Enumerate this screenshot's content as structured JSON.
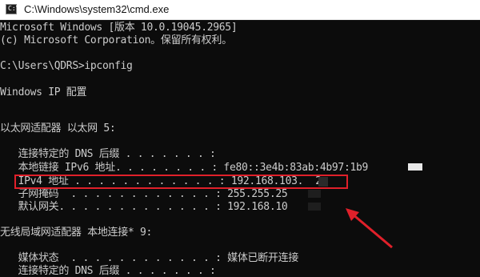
{
  "window": {
    "title": "C:\\Windows\\system32\\cmd.exe",
    "icon": "cmd-icon",
    "icon_prompt": "C:\\"
  },
  "console": {
    "lines": [
      "Microsoft Windows [版本 10.0.19045.2965]",
      "(c) Microsoft Corporation。保留所有权利。",
      "",
      "C:\\Users\\QDRS>ipconfig",
      "",
      "Windows IP 配置",
      "",
      "",
      "以太网适配器 以太网 5:",
      "",
      "   连接特定的 DNS 后缀 . . . . . . . :",
      "   本地链接 IPv6 地址. . . . . . . . : fe80::3e4b:83ab:4b97:1b9",
      "   IPv4 地址 . . . . . . . . . . . . : 192.168.103.  2",
      "   子网掩码  . . . . . . . . . . . . : 255.255.25",
      "   默认网关. . . . . . . . . . . . . : 192.168.10",
      "",
      "无线局域网适配器 本地连接* 9:",
      "",
      "   媒体状态  . . . . . . . . . . . . : 媒体已断开连接",
      "   连接特定的 DNS 后缀 . . . . . . . :"
    ]
  },
  "annotation": {
    "highlight_color": "#e0202a",
    "arrow_icon": "arrow-icon"
  },
  "colors": {
    "console_background": "#0c0c0c",
    "console_text": "#cccccc",
    "titlebar_background": "#ffffff"
  }
}
